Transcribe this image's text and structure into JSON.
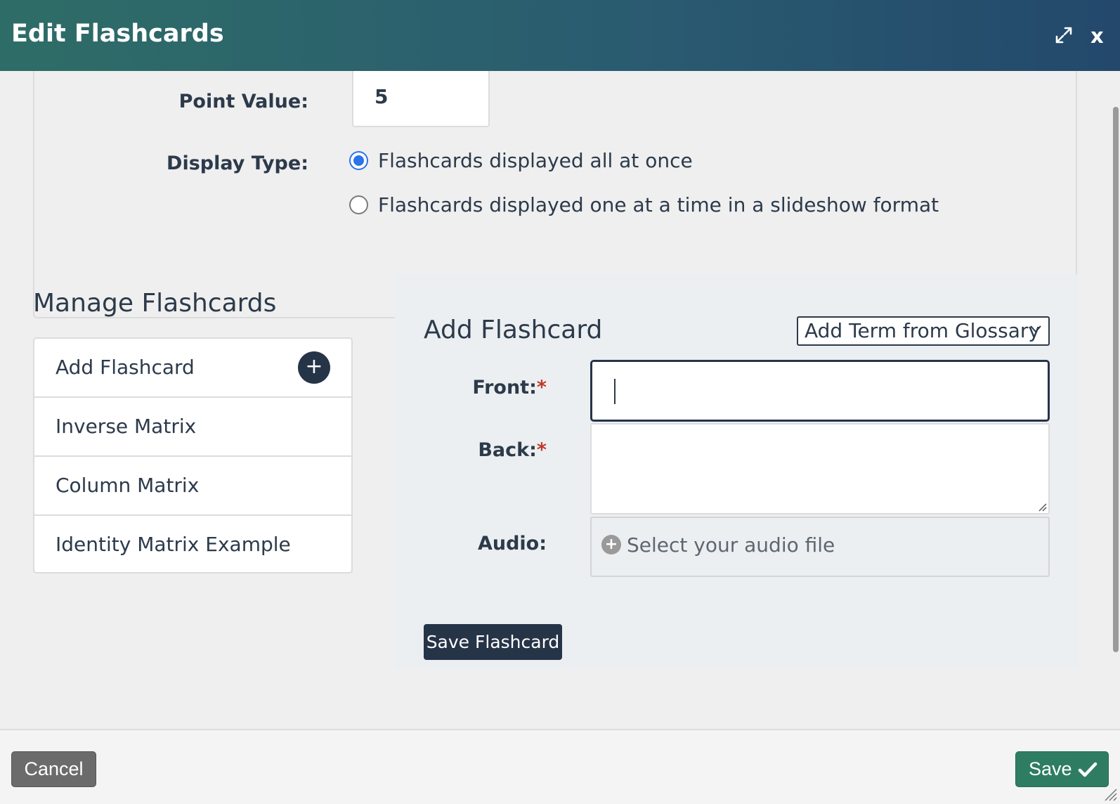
{
  "header": {
    "title": "Edit Flashcards",
    "close_label": "x",
    "expand_icon": "expand-icon",
    "gradient_colors": [
      "#2e6d67",
      "#23486c"
    ]
  },
  "settings": {
    "point_value_label": "Point Value:",
    "point_value": "5",
    "display_type_label": "Display Type:",
    "display_options": [
      {
        "label": "Flashcards displayed all at once",
        "selected": true
      },
      {
        "label": "Flashcards displayed one at a time in a slideshow format",
        "selected": false
      }
    ]
  },
  "manage": {
    "title": "Manage Flashcards",
    "items": [
      {
        "label": "Add Flashcard",
        "icon": "plus-icon"
      },
      {
        "label": "Inverse Matrix"
      },
      {
        "label": "Column Matrix"
      },
      {
        "label": "Identity Matrix Example"
      }
    ]
  },
  "add_flashcard": {
    "title": "Add Flashcard",
    "glossary_select": "Add Term from Glossary",
    "front_label": "Front:",
    "back_label": "Back:",
    "required_mark": "*",
    "front_value": "",
    "back_value": "",
    "audio_label": "Audio:",
    "audio_placeholder": "Select your audio file",
    "save_button": "Save Flashcard"
  },
  "footer": {
    "cancel_label": "Cancel",
    "save_label": "Save"
  },
  "colors": {
    "primary_dark": "#263448",
    "save_green": "#2e7d62",
    "radio_blue": "#2b73e8",
    "required_red": "#c0392b"
  }
}
